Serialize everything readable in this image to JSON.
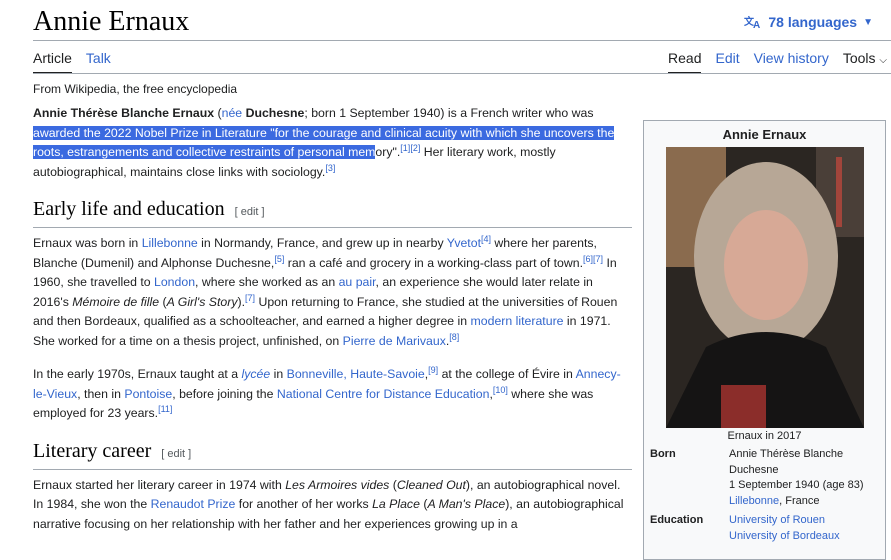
{
  "page": {
    "title": "Annie Ernaux",
    "languages": "78 languages",
    "tagline": "From Wikipedia, the free encyclopedia"
  },
  "tabs": {
    "left": [
      "Article",
      "Talk"
    ],
    "right": [
      "Read",
      "Edit",
      "View history",
      "Tools"
    ]
  },
  "lead": {
    "name": "Annie Thérèse Blanche Ernaux",
    "paren_open": " (",
    "nee": "née",
    "space": " ",
    "maiden": "Duchesne",
    "born": "; born 1 September 1940) is a French writer who was ",
    "selected": "awarded the 2022 Nobel Prize in Literature \"for the courage and clinical acuity with which she uncovers the roots, estrangements and collective restraints of personal mem",
    "after_sel": "ory\".",
    "ref1": "[1]",
    "ref2": "[2]",
    "rest": " Her literary work, mostly autobiographical, maintains close links with sociology.",
    "ref3": "[3]"
  },
  "sections": {
    "early_title": "Early life and education",
    "literary_title": "Literary career",
    "edit": "[ edit ]"
  },
  "early": {
    "p1": {
      "t1": "Ernaux was born in ",
      "l1": "Lillebonne",
      "t2": " in Normandy, France, and grew up in nearby ",
      "l2": "Yvetot",
      "r4": "[4]",
      "t3": " where her parents, Blanche (Dumenil) and Alphonse Duchesne,",
      "r5": "[5]",
      "t4": " ran a café and grocery in a working-class part of town.",
      "r67": "[6][7]",
      "t5": " In 1960, she travelled to ",
      "l3": "London",
      "t6": ", where she worked as an ",
      "l4": "au pair",
      "t7": ", an experience she would later relate in 2016's ",
      "i1": "Mémoire de fille",
      "t8": " (",
      "i2": "A Girl's Story",
      "t9": ").",
      "r7": "[7]",
      "t10": " Upon returning to France, she studied at the universities of Rouen and then Bordeaux, qualified as a schoolteacher, and earned a higher degree in ",
      "l5": "modern literature",
      "t11": " in 1971. She worked for a time on a thesis project, unfinished, on ",
      "l6": "Pierre de Marivaux",
      "t12": ".",
      "r8": "[8]"
    },
    "p2": {
      "t1": "In the early 1970s, Ernaux taught at a ",
      "l1": "lycée",
      "t2": " in ",
      "l2": "Bonneville, Haute-Savoie",
      "t2b": ",",
      "r9": "[9]",
      "t3": " at the college of Évire in ",
      "l3": "Annecy-le-Vieux",
      "t4": ", then in ",
      "l4": "Pontoise",
      "t5": ", before joining the ",
      "l5": "National Centre for Distance Education",
      "t5b": ",",
      "r10": "[10]",
      "t6": " where she was employed for 23 years.",
      "r11": "[11]"
    }
  },
  "literary": {
    "t1": "Ernaux started her literary career in 1974 with ",
    "i1": "Les Armoires vides",
    "t2": " (",
    "i2": "Cleaned Out",
    "t3": "), an autobiographical novel. In 1984, she won the ",
    "l1": "Renaudot Prize",
    "t4": " for another of her works ",
    "i3": "La Place",
    "t5": " (",
    "i4": "A Man's Place",
    "t6": "), an autobiographical narrative focusing on her relationship with her father and her experiences growing up in a"
  },
  "infobox": {
    "title": "Annie Ernaux",
    "caption": "Ernaux in 2017",
    "born_label": "Born",
    "born_lines": [
      "Annie Thérèse Blanche",
      "Duchesne",
      "1 September 1940 (age 83)"
    ],
    "born_place_link": "Lillebonne",
    "born_place_rest": ", France",
    "education_label": "Education",
    "education": [
      "University of Rouen",
      "University of Bordeaux"
    ]
  },
  "colors": {
    "link": "#3366cc",
    "selection": "#3b6ae0",
    "rule": "#a2a9b1",
    "infobox_bg": "#f8f9fa"
  },
  "icons": {
    "language": "translate-icon",
    "dropdown": "chevron-down-icon"
  }
}
